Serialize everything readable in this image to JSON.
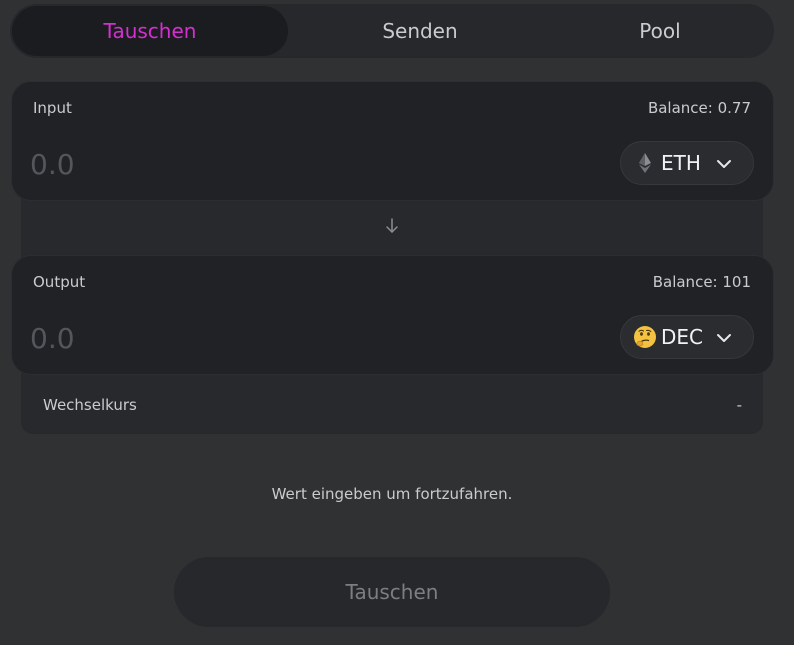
{
  "tabs": [
    {
      "label": "Tauschen",
      "active": true
    },
    {
      "label": "Senden",
      "active": false
    },
    {
      "label": "Pool",
      "active": false
    }
  ],
  "input_panel": {
    "label": "Input",
    "balance": "Balance: 0.77",
    "amount_placeholder": "0.0",
    "token": {
      "symbol": "ETH",
      "icon": "ethereum-icon"
    }
  },
  "output_panel": {
    "label": "Output",
    "balance": "Balance: 101",
    "amount_placeholder": "0.0",
    "token": {
      "symbol": "DEC",
      "icon": "thinking-face-emoji",
      "emoji": "🤔"
    }
  },
  "exchange_rate": {
    "label": "Wechselkurs",
    "value": "-"
  },
  "hint": "Wert eingeben um fortzufahren.",
  "submit_label": "Tauschen",
  "colors": {
    "accent": "#d52fd1",
    "background": "#2f3133",
    "panel": "#212225"
  }
}
